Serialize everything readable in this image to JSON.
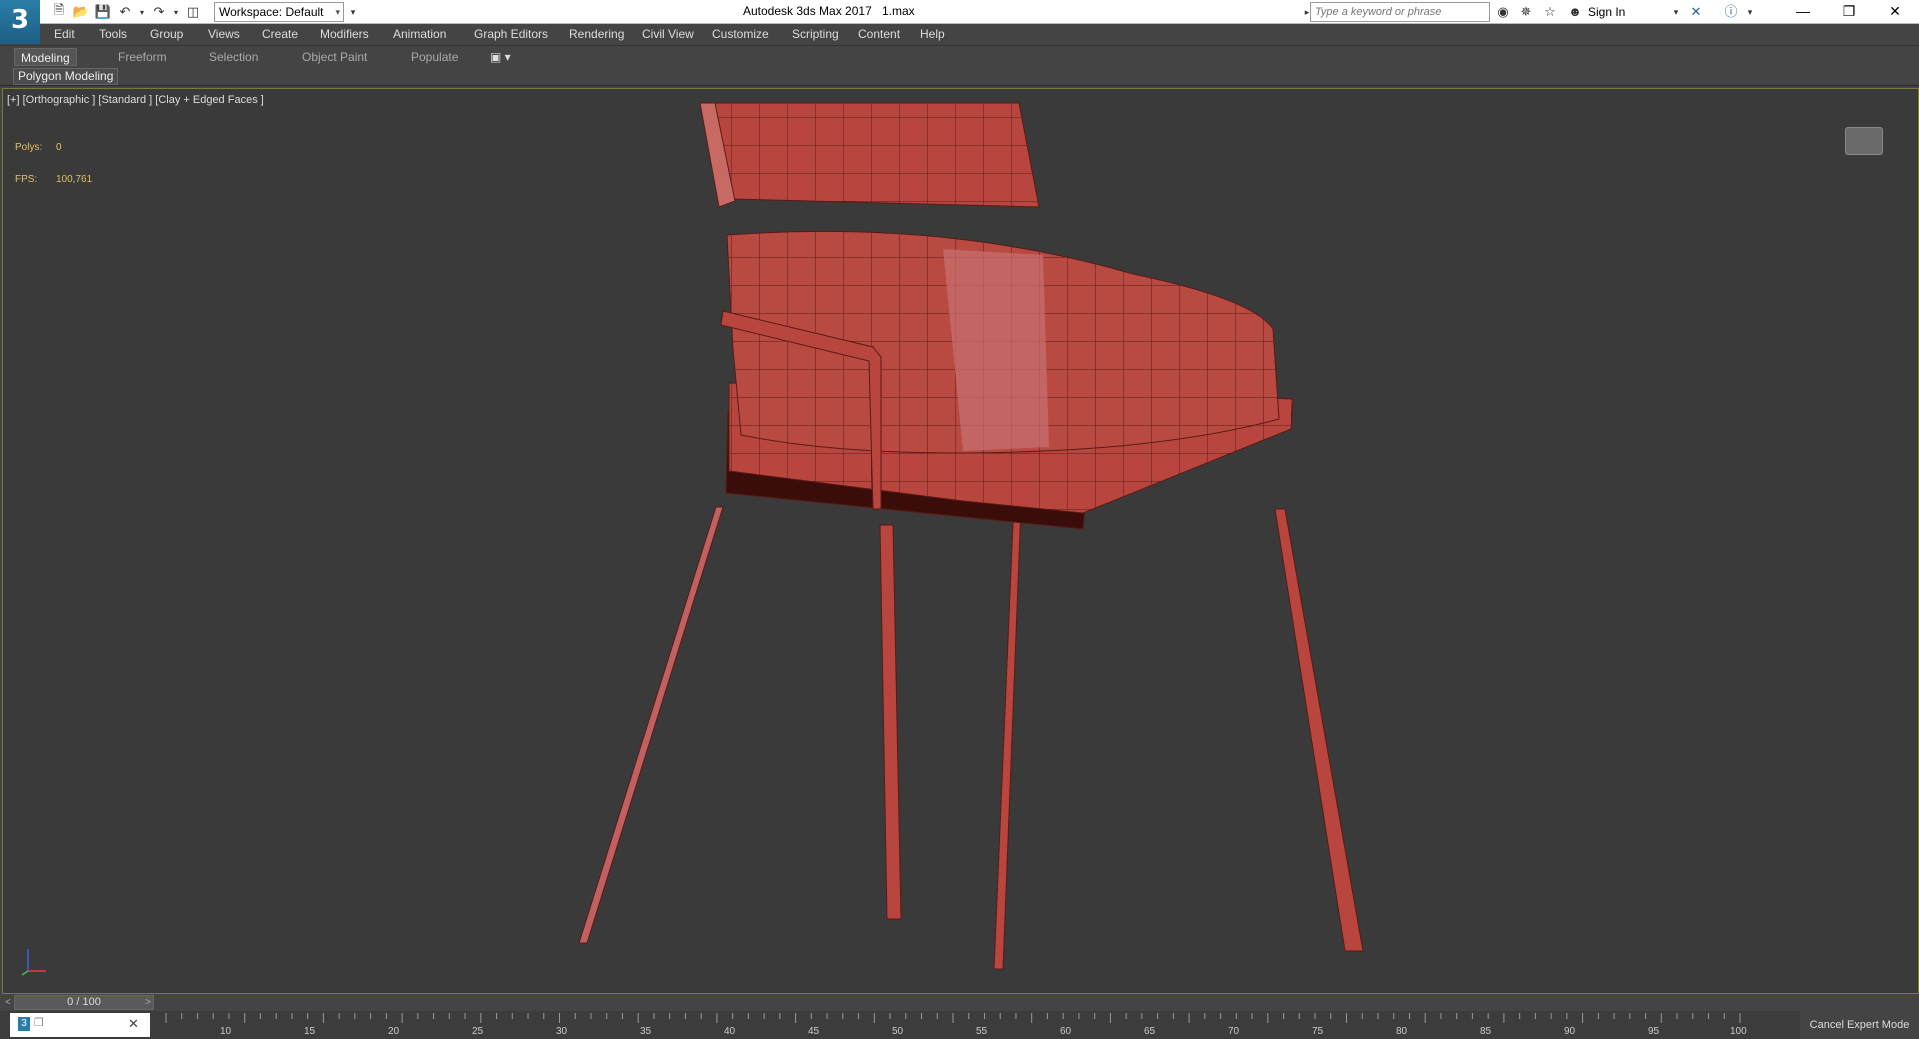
{
  "title_bar": {
    "app_title": "Autodesk 3ds Max 2017",
    "file_name": "1.max",
    "logo_glyph": "3",
    "workspace_label": "Workspace: Default",
    "search_placeholder": "Type a keyword or phrase",
    "sign_in": "Sign In"
  },
  "menu": [
    "Edit",
    "Tools",
    "Group",
    "Views",
    "Create",
    "Modifiers",
    "Animation",
    "Graph Editors",
    "Rendering",
    "Civil View",
    "Customize",
    "Scripting",
    "Content",
    "Help"
  ],
  "ribbon": {
    "tabs": [
      "Modeling",
      "Freeform",
      "Selection",
      "Object Paint",
      "Populate"
    ],
    "active_tab": "Modeling",
    "panel_label": "Polygon Modeling"
  },
  "viewport": {
    "label": "[+] [Orthographic ] [Standard ] [Clay + Edged Faces ]",
    "polys_label": "Polys:",
    "polys_value": "0",
    "fps_label": "FPS:",
    "fps_value": "100,761",
    "model_color": "#b8463e"
  },
  "timeline": {
    "frame_display": "0 / 100",
    "ticks": [
      "10",
      "15",
      "20",
      "25",
      "30",
      "35",
      "40",
      "45",
      "50",
      "55",
      "60",
      "65",
      "70",
      "75",
      "80",
      "85",
      "90",
      "95",
      "100"
    ]
  },
  "status": {
    "cancel_expert_mode": "Cancel Expert Mode"
  }
}
